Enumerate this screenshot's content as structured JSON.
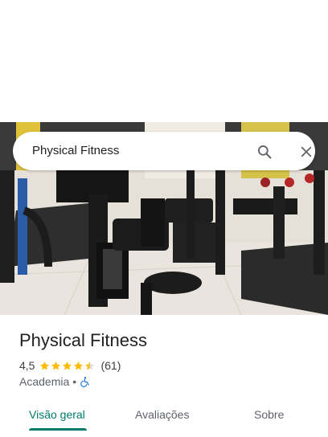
{
  "search": {
    "query": "Physical Fitness",
    "search_icon": "search-icon",
    "close_icon": "close-icon"
  },
  "place": {
    "name": "Physical Fitness",
    "rating": "4,5",
    "stars": 4.5,
    "review_count": "(61)",
    "category": "Academia",
    "separator": "•",
    "accessibility_icon": "wheelchair-icon"
  },
  "tabs": [
    {
      "label": "Visão geral",
      "active": true
    },
    {
      "label": "Avaliações",
      "active": false
    },
    {
      "label": "Sobre",
      "active": false
    }
  ],
  "colors": {
    "accent": "#00796b",
    "star": "#fbbc04",
    "accessibility": "#1a73e8"
  }
}
